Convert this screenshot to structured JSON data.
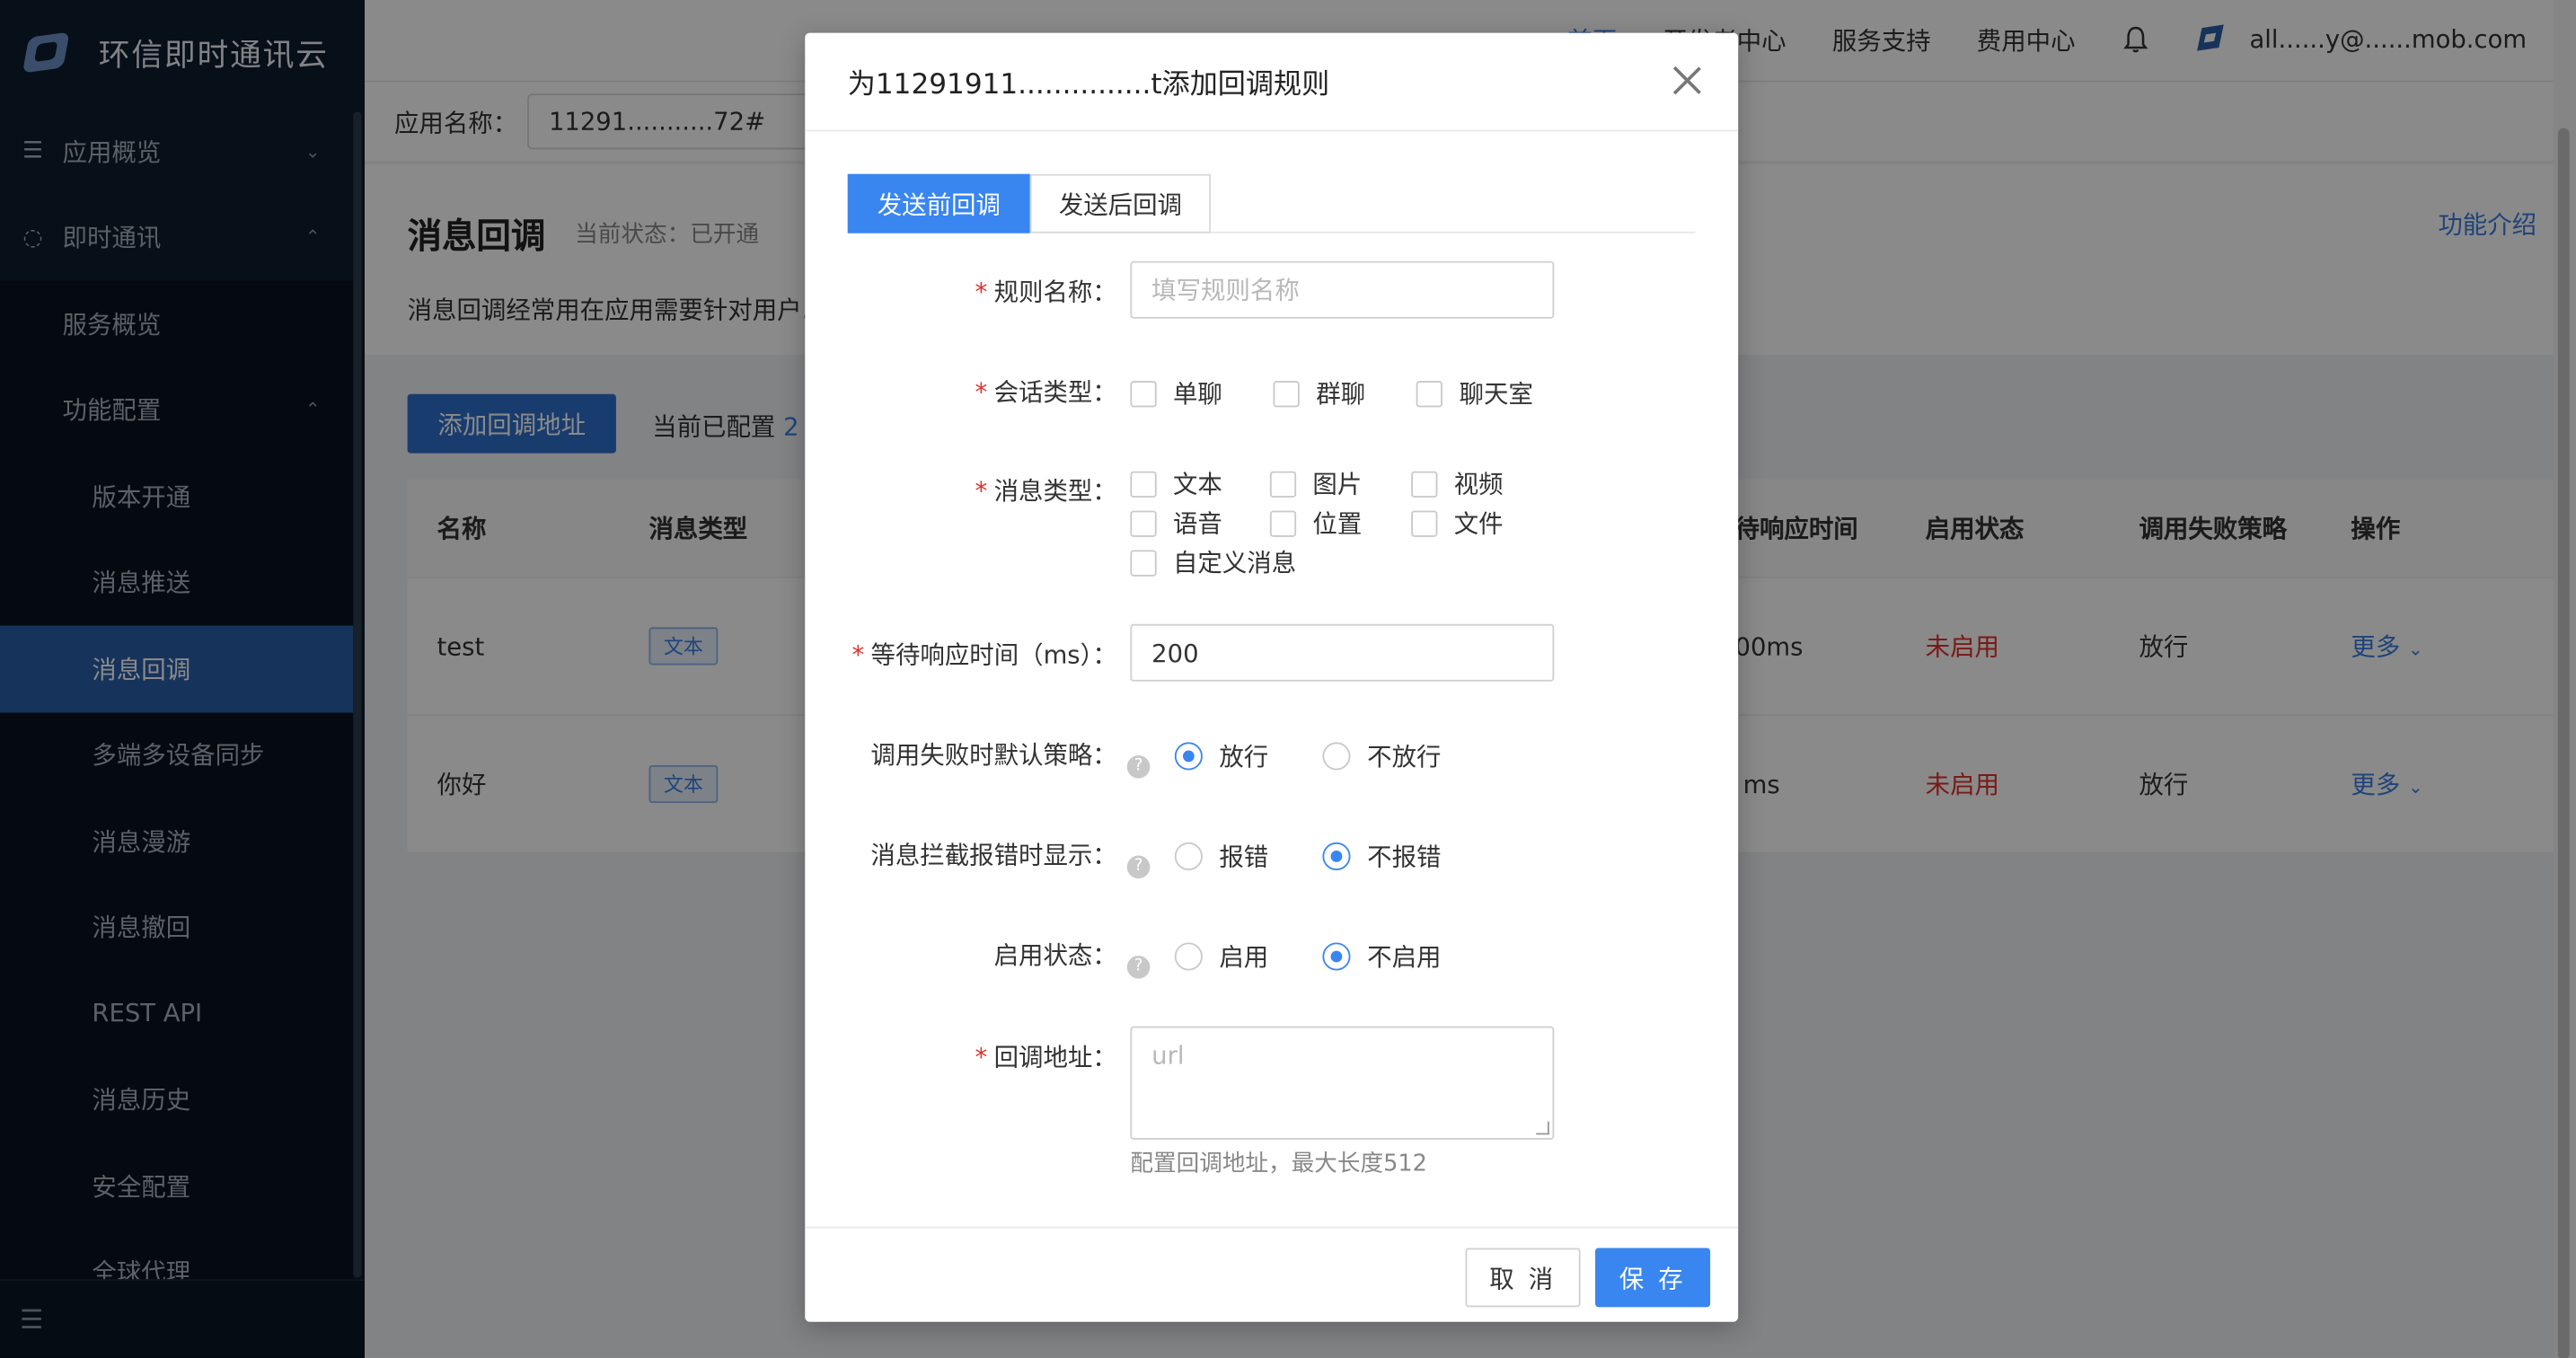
{
  "brand": {
    "name": "环信即时通讯云"
  },
  "sidebar": {
    "items": [
      {
        "label": "应用概览",
        "icon": "list-icon"
      },
      {
        "label": "即时通讯",
        "icon": "chat-icon"
      },
      {
        "label": "服务概览"
      },
      {
        "label": "功能配置"
      },
      {
        "label": "版本开通"
      },
      {
        "label": "消息推送"
      },
      {
        "label": "消息回调"
      },
      {
        "label": "多端多设备同步"
      },
      {
        "label": "消息漫游"
      },
      {
        "label": "消息撤回"
      },
      {
        "label": "REST API"
      },
      {
        "label": "消息历史"
      },
      {
        "label": "安全配置"
      },
      {
        "label": "全球代理"
      }
    ]
  },
  "topnav": {
    "home": "首页",
    "dev_center": "开发者中心",
    "support": "服务支持",
    "billing": "费用中心",
    "email": "all......y@......mob.com"
  },
  "appbar": {
    "label": "应用名称：",
    "value": "11291...........72#"
  },
  "page": {
    "title": "消息回调",
    "status": "当前状态：已开通",
    "description": "消息回调经常用在应用需要针对用户......己的服务端实时保存聊天历史",
    "intro_link": "功能介绍",
    "add_button": "添加回调地址",
    "configured_label": "当前已配置",
    "configured_count": "2"
  },
  "table": {
    "headers": [
      "名称",
      "消息类型",
      "待响应时间",
      "启用状态",
      "调用失败策略",
      "操作"
    ],
    "rows": [
      {
        "name": "test",
        "type": "文本",
        "wait": "00ms",
        "status": "未启用",
        "strategy": "放行",
        "action": "更多"
      },
      {
        "name": "你好",
        "type": "文本",
        "wait": "ms",
        "status": "未启用",
        "strategy": "放行",
        "action": "更多"
      }
    ]
  },
  "modal": {
    "title": "为11291911...............t添加回调规则",
    "tabs": [
      "发送前回调",
      "发送后回调"
    ],
    "rule_name": {
      "label": "规则名称：",
      "placeholder": "填写规则名称"
    },
    "session_type": {
      "label": "会话类型：",
      "options": [
        "单聊",
        "群聊",
        "聊天室"
      ]
    },
    "msg_type": {
      "label": "消息类型：",
      "options": [
        "文本",
        "图片",
        "视频",
        "语音",
        "位置",
        "文件",
        "自定义消息"
      ]
    },
    "wait_time": {
      "label": "等待响应时间（ms）：",
      "value": "200"
    },
    "fail_strategy": {
      "label": "调用失败时默认策略：",
      "options": [
        "放行",
        "不放行"
      ],
      "selected": "放行"
    },
    "intercept_error": {
      "label": "消息拦截报错时显示：",
      "options": [
        "报错",
        "不报错"
      ],
      "selected": "不报错"
    },
    "enable_status": {
      "label": "启用状态：",
      "options": [
        "启用",
        "不启用"
      ],
      "selected": "不启用"
    },
    "callback_url": {
      "label": "回调地址：",
      "placeholder": "url",
      "hint": "配置回调地址，最大长度512"
    },
    "cancel": "取 消",
    "save": "保 存"
  },
  "colors": {
    "accent": "#3a86f0",
    "sidebar_bg": "#0d1d2e",
    "active_nav": "#2a5fa8",
    "danger": "#e0302a"
  }
}
